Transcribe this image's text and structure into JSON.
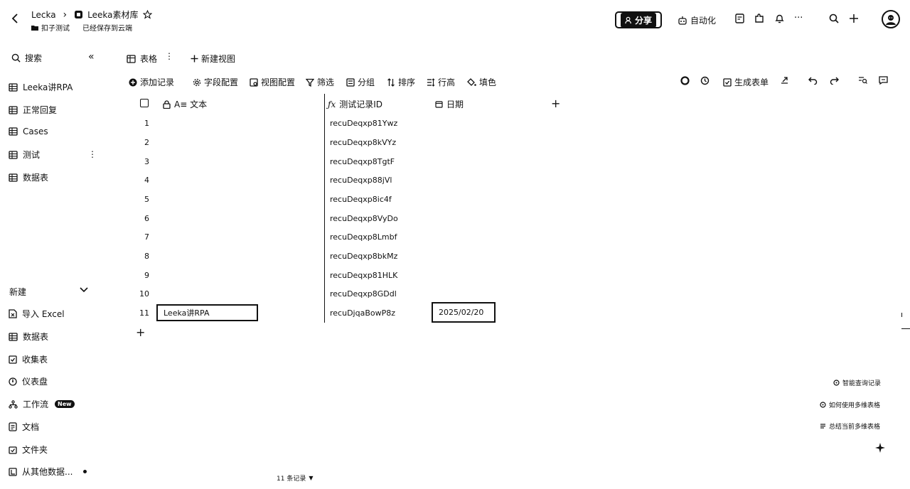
{
  "header": {
    "workspace": "Lecka",
    "doc_title": "Leeka素材库",
    "folder": "扣子测试",
    "save_status": "已经保存到云端",
    "share_label": "分享",
    "automation_label": "自动化"
  },
  "sidebar": {
    "search_label": "搜索",
    "items": [
      {
        "label": "Leeka讲RPA",
        "icon": "table-icon"
      },
      {
        "label": "正常回复",
        "icon": "table-icon"
      },
      {
        "label": "Cases",
        "icon": "table-icon"
      },
      {
        "label": "测试",
        "icon": "table-icon"
      },
      {
        "label": "数据表",
        "icon": "table-icon"
      }
    ],
    "new_label": "新建",
    "new_items": [
      {
        "label": "导入 Excel",
        "icon": "excel-icon"
      },
      {
        "label": "数据表",
        "icon": "table-icon"
      },
      {
        "label": "收集表",
        "icon": "form-icon"
      },
      {
        "label": "仪表盘",
        "icon": "dashboard-icon"
      },
      {
        "label": "工作流",
        "icon": "workflow-icon",
        "badge": "New"
      },
      {
        "label": "文档",
        "icon": "doc-icon"
      },
      {
        "label": "文件夹",
        "icon": "folder-icon"
      },
      {
        "label": "从其他数据...",
        "icon": "import-icon"
      }
    ]
  },
  "view": {
    "tab_label": "表格",
    "add_view_label": "新建视图"
  },
  "toolbar": {
    "add_record": "添加记录",
    "field_config": "字段配置",
    "view_config": "视图配置",
    "filter": "筛选",
    "group": "分组",
    "sort": "排序",
    "row_height": "行高",
    "fill_color": "填色",
    "generate_form": "生成表单"
  },
  "grid": {
    "columns": [
      "A≡ 文本",
      "测试记录ID",
      "日期"
    ],
    "rows": [
      {
        "n": "1",
        "id": "recuDeqxp81Ywz",
        "text": "",
        "date": ""
      },
      {
        "n": "2",
        "id": "recuDeqxp8kVYz",
        "text": "",
        "date": ""
      },
      {
        "n": "3",
        "id": "recuDeqxp8TgtF",
        "text": "",
        "date": ""
      },
      {
        "n": "4",
        "id": "recuDeqxp88jVl",
        "text": "",
        "date": ""
      },
      {
        "n": "5",
        "id": "recuDeqxp8ic4f",
        "text": "",
        "date": ""
      },
      {
        "n": "6",
        "id": "recuDeqxp8VyDo",
        "text": "",
        "date": ""
      },
      {
        "n": "7",
        "id": "recuDeqxp8Lmbf",
        "text": "",
        "date": ""
      },
      {
        "n": "8",
        "id": "recuDeqxp8bkMz",
        "text": "",
        "date": ""
      },
      {
        "n": "9",
        "id": "recuDeqxp81HLK",
        "text": "",
        "date": ""
      },
      {
        "n": "10",
        "id": "recuDeqxp8GDdl",
        "text": "",
        "date": ""
      },
      {
        "n": "11",
        "id": "recuDjqaBowP8z",
        "text": "Leeka讲RPA",
        "date": "2025/02/20"
      }
    ]
  },
  "helpers": {
    "smart_query": "智能查询记录",
    "how_to_use": "如何使用多维表格",
    "summarize": "总结当前多维表格"
  },
  "footer": {
    "record_count": "11 条记录"
  }
}
